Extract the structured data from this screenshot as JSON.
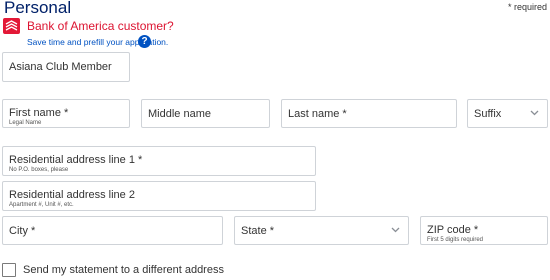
{
  "section": {
    "title": "Personal",
    "required_note": "* required"
  },
  "boa": {
    "title": "Bank of America customer?",
    "subtitle": "Save time and prefill your application.",
    "help": "?"
  },
  "fields": {
    "club": {
      "label": "Asiana Club Member"
    },
    "first_name": {
      "label": "First name *",
      "hint": "Legal Name"
    },
    "middle_name": {
      "label": "Middle name"
    },
    "last_name": {
      "label": "Last name *"
    },
    "suffix": {
      "label": "Suffix"
    },
    "address1": {
      "label": "Residential address line 1 *",
      "hint": "No P.O. boxes, please"
    },
    "address2": {
      "label": "Residential address line 2",
      "hint": "Apartment #, Unit #, etc."
    },
    "city": {
      "label": "City *"
    },
    "state": {
      "label": "State *"
    },
    "zip": {
      "label": "ZIP code *",
      "hint": "First 5 digits required"
    }
  },
  "statement": {
    "label": "Send my statement to a different address",
    "checked": false
  },
  "colors": {
    "brand_red": "#e31837",
    "navy": "#012169",
    "link_blue": "#0052c2",
    "border": "#cfd3d8"
  }
}
